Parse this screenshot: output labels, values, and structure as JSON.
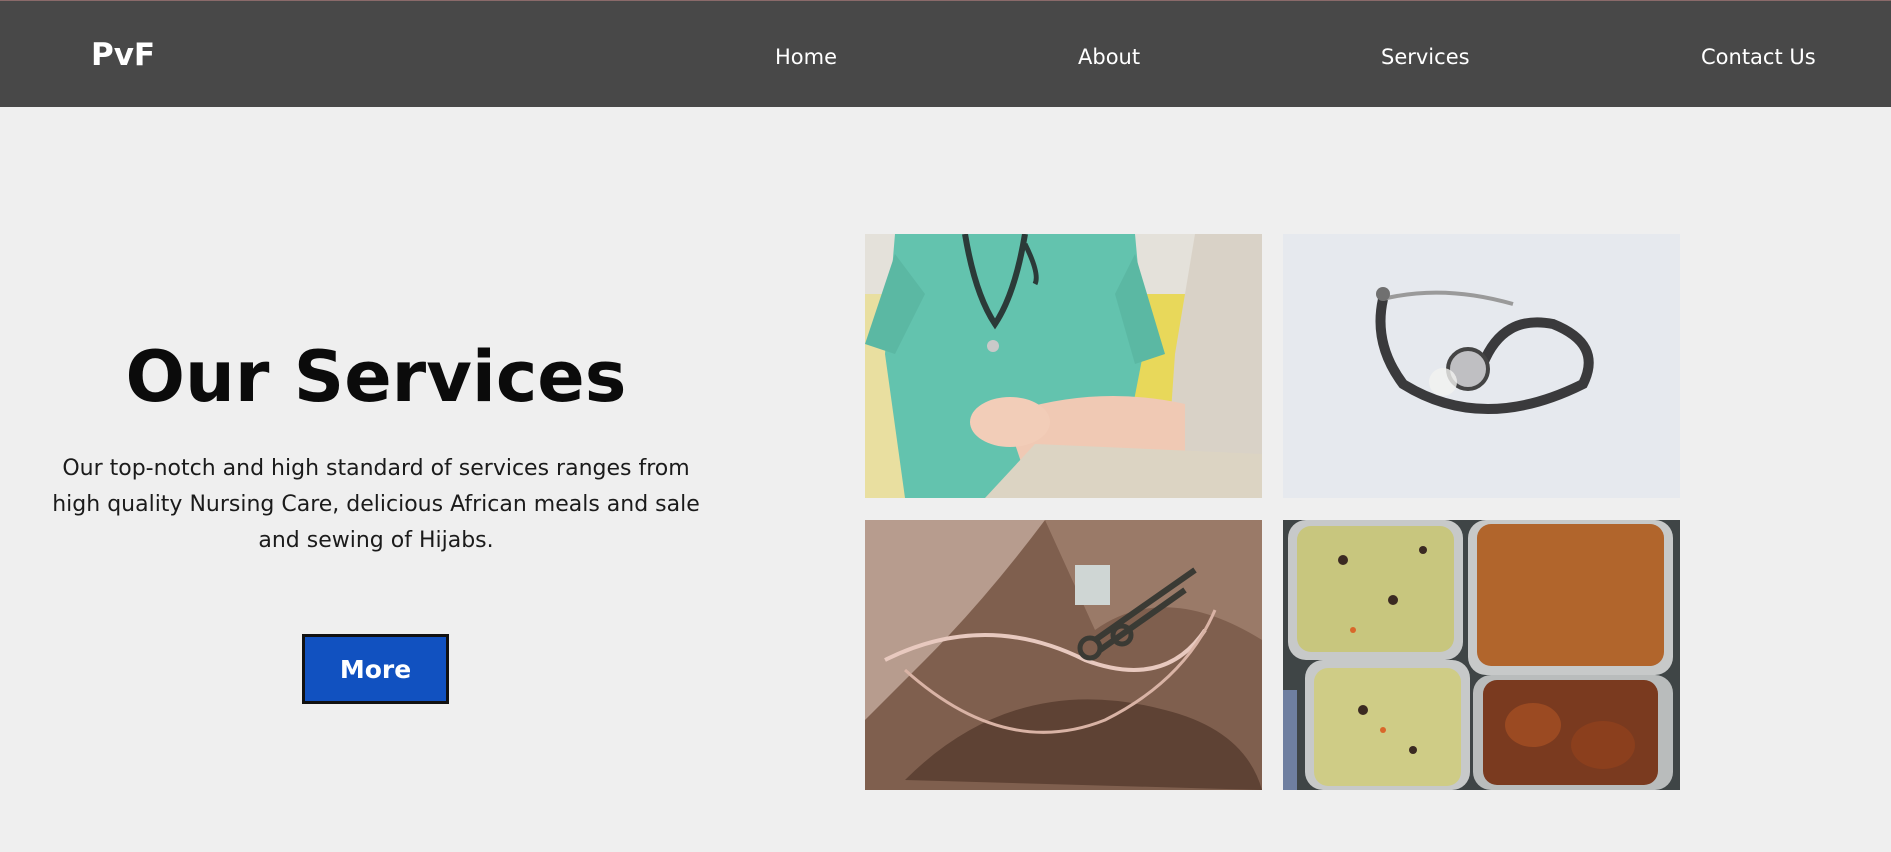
{
  "header": {
    "logo": "PvF",
    "nav": [
      "Home",
      "About",
      "Services",
      "Contact Us"
    ]
  },
  "hero": {
    "title": "Our Services",
    "description": "Our top-notch and high standard of services ranges from high quality Nursing Care, delicious African meals and sale and sewing of Hijabs.",
    "button_label": "More"
  },
  "colors": {
    "header_bg": "#484848",
    "page_bg": "#efefef",
    "button_bg": "#1151c0"
  }
}
